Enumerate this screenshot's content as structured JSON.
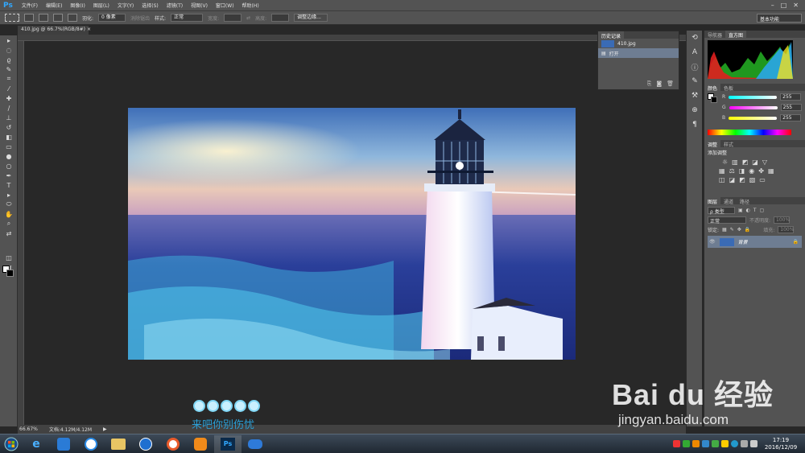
{
  "app": {
    "logo": "Ps"
  },
  "menu": [
    "文件(F)",
    "编辑(E)",
    "图像(I)",
    "图层(L)",
    "文字(Y)",
    "选择(S)",
    "滤镜(T)",
    "视图(V)",
    "窗口(W)",
    "帮助(H)"
  ],
  "options": {
    "feather_label": "羽化:",
    "feather_value": "0 像素",
    "antialias": "消除锯齿",
    "style_label": "样式:",
    "style_value": "正常",
    "width_label": "宽度:",
    "height_label": "高度:",
    "refine_edge": "调整边缘...",
    "workspace": "基本功能"
  },
  "document": {
    "tab_label": "410.jpg @ 66.7%(RGB/8#)",
    "zoom": "66.67%",
    "doc_size": "文档:4.12M/4.12M"
  },
  "history": {
    "tab_active": "历史记录",
    "snapshot": "410.jpg",
    "item": "打开"
  },
  "histogram": {
    "tab1": "导航器",
    "tab2": "直方图"
  },
  "color_panel": {
    "tab1": "颜色",
    "tab2": "色板",
    "r_label": "R",
    "r_value": "255",
    "g_label": "G",
    "g_value": "255",
    "b_label": "B",
    "b_value": "255"
  },
  "adjustments": {
    "tab1": "调整",
    "tab2": "样式",
    "title": "添加调整"
  },
  "layers": {
    "tab1": "图层",
    "tab2": "通道",
    "tab3": "路径",
    "kind": "ρ 类型",
    "blend": "正常",
    "opacity_label": "不透明度:",
    "opacity_value": "100%",
    "lock_label": "锁定:",
    "fill_label": "填充:",
    "fill_value": "100%",
    "layer_name": "背景"
  },
  "overlay": {
    "caption": "来吧你别伤忧",
    "watermark": "Bai du 经验",
    "watermark_url": "jingyan.baidu.com"
  },
  "taskbar": {
    "time": "17:19",
    "date": "2016/12/09"
  },
  "colors": {
    "accent": "#31a8ff",
    "panel": "#535353",
    "canvas": "#282828"
  }
}
